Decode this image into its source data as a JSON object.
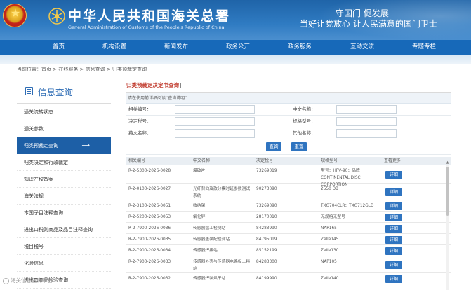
{
  "header": {
    "site_title": "中华人民共和国海关总署",
    "site_subtitle": "General Administration of Customs of the People's Republic of China",
    "slogan_line1": "守国门    促发展",
    "slogan_line2": "当好让党放心    让人民满意的国门卫士",
    "bg_color": "#1f64a8"
  },
  "nav": {
    "items": [
      "首页",
      "机构设置",
      "新闻发布",
      "政务公开",
      "政务服务",
      "互动交流",
      "专题专栏"
    ]
  },
  "breadcrumb": {
    "prefix": "当前位置：",
    "items": [
      "首页",
      "在线服务",
      "信息查询",
      "归类预裁定查询"
    ],
    "sep": " > "
  },
  "sidebar": {
    "title": "信息查询",
    "active_index": 3,
    "items": [
      "通关流转状态",
      "通关参数",
      "归类预裁定查询",
      "归类决定和行政裁定",
      "知识产权备案",
      "海关法规",
      "本国子目注释查询",
      "进出口税则商品及品目注释查询",
      "税目税号",
      "化验信息",
      "进出口商品检验查询"
    ]
  },
  "content": {
    "panel_title": "归类预裁定决定书查询",
    "note": "请在使用前详细阅读“查询说明”",
    "form": {
      "fields": [
        [
          "相关编号：",
          "中文名称："
        ],
        [
          "决定税号：",
          "规格型号："
        ],
        [
          "英文名称：",
          "其他名称："
        ]
      ],
      "search_label": "查询",
      "reset_label": "重置"
    },
    "table": {
      "headers": [
        "相关编号",
        "中文名称",
        "决定税号",
        "规格型号",
        "查看更多"
      ],
      "detail_label": "详细",
      "rows": [
        {
          "id": "R-2-5300-2026-0028",
          "name": "爆破片",
          "code": "73269019",
          "spec": "型号：HPV-90；品牌 CONTINENTAL DISC CORPORTION"
        },
        {
          "id": "R-2-0100-2026-0027",
          "name": "光纤背向及散分模时延参数测试系统",
          "code": "90273090",
          "spec": "2550 DB"
        },
        {
          "id": "R-2-3100-2026-0051",
          "name": "收纳架",
          "code": "73269090",
          "spec": "TXG704CLR；TXG712GLD"
        },
        {
          "id": "R-2-5200-2026-0053",
          "name": "氧化锌",
          "code": "28170010",
          "spec": "无规格无型号"
        },
        {
          "id": "R-2-7900-2026-0036",
          "name": "传感器温工检测站",
          "code": "84283990",
          "spec": "NAP165"
        },
        {
          "id": "R-2-7900-2026-0035",
          "name": "传感器盖装配检测站",
          "code": "84795019",
          "spec": "Zelle145"
        },
        {
          "id": "R-2-7900-2026-0034",
          "name": "传感器焊接站",
          "code": "85152199",
          "spec": "Zelle130"
        },
        {
          "id": "R-2-7900-2026-0033",
          "name": "传感器外壳与传感器电路板上料站",
          "code": "84283300",
          "spec": "NAP105"
        },
        {
          "id": "R-2-7900-2026-0032",
          "name": "传感器焊装烘干站",
          "code": "84199990",
          "spec": "Zelle140"
        }
      ]
    }
  },
  "watermark": "海关信息查询平台"
}
